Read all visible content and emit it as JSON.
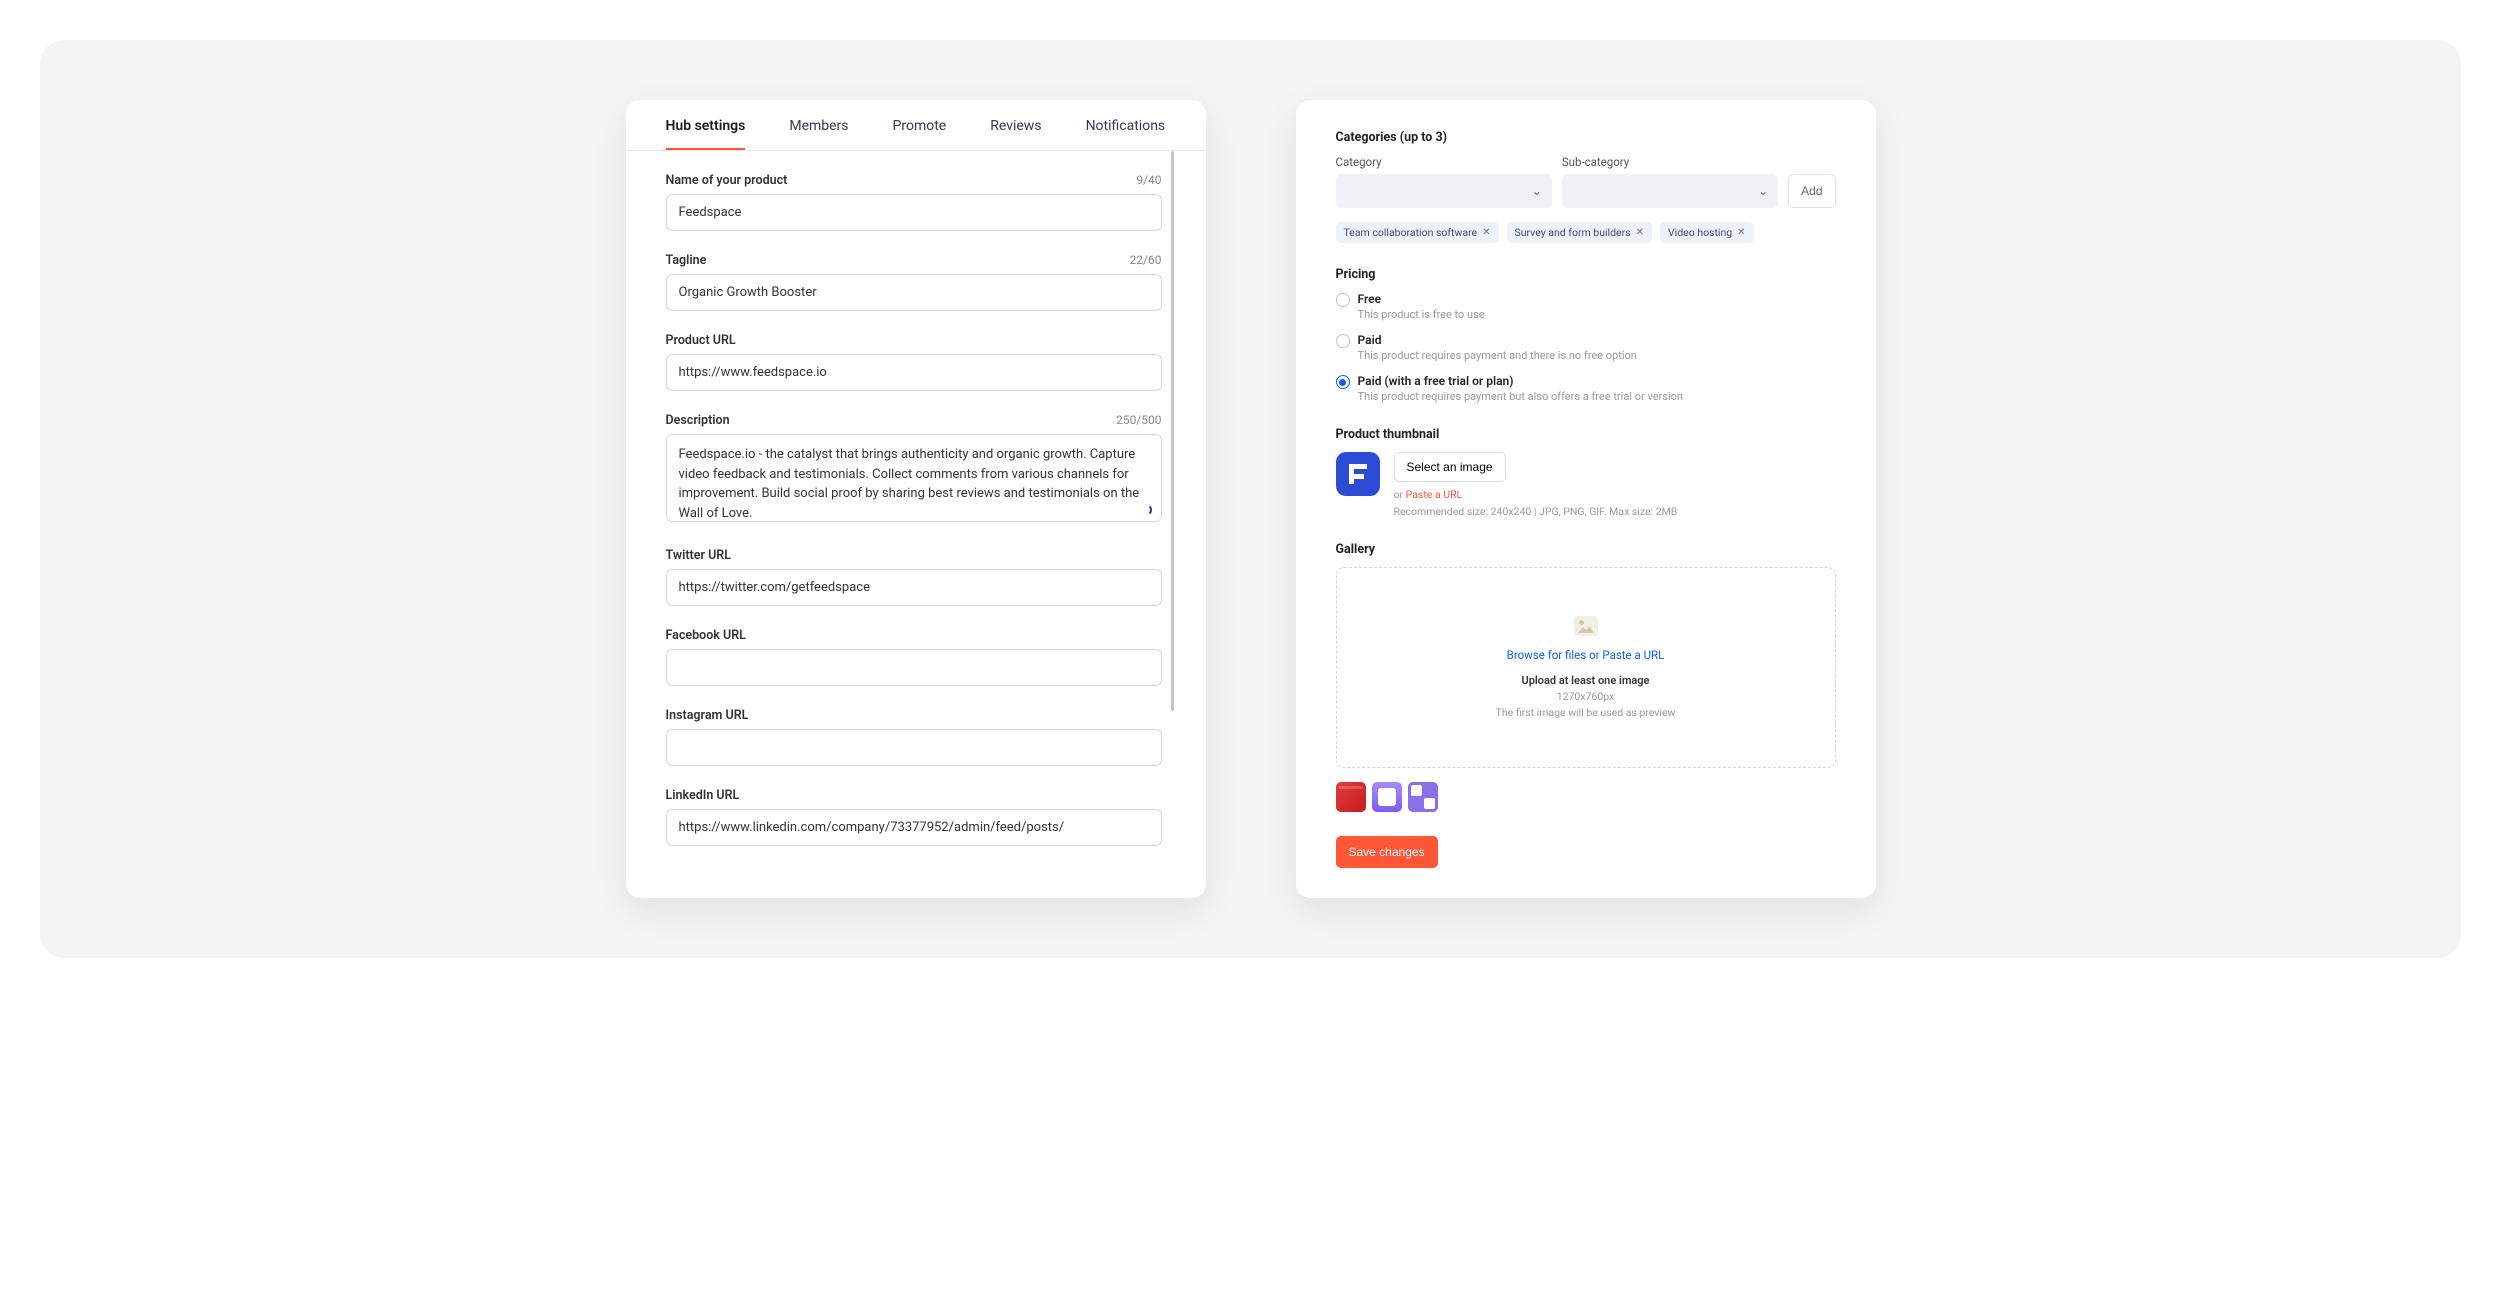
{
  "tabs": {
    "hub_settings": "Hub settings",
    "members": "Members",
    "promote": "Promote",
    "reviews": "Reviews",
    "notifications": "Notifications"
  },
  "fields": {
    "product_name": {
      "label": "Name of your product",
      "count": "9/40",
      "value": "Feedspace"
    },
    "tagline": {
      "label": "Tagline",
      "count": "22/60",
      "value": "Organic Growth Booster"
    },
    "product_url": {
      "label": "Product URL",
      "value": "https://www.feedspace.io"
    },
    "description": {
      "label": "Description",
      "count": "250/500",
      "value": "Feedspace.io - the catalyst that brings authenticity and organic growth. Capture video feedback and testimonials. Collect comments from various channels for improvement. Build social proof by sharing best reviews and testimonials on the Wall of Love."
    },
    "twitter": {
      "label": "Twitter URL",
      "value": "https://twitter.com/getfeedspace"
    },
    "facebook": {
      "label": "Facebook URL",
      "value": ""
    },
    "instagram": {
      "label": "Instagram URL",
      "value": ""
    },
    "linkedin": {
      "label": "LinkedIn URL",
      "value": "https://www.linkedin.com/company/73377952/admin/feed/posts/"
    }
  },
  "categories": {
    "heading": "Categories (up to 3)",
    "category_label": "Category",
    "subcategory_label": "Sub-category",
    "add_label": "Add",
    "chips": [
      "Team collaboration software",
      "Survey and form builders",
      "Video hosting"
    ]
  },
  "pricing": {
    "heading": "Pricing",
    "options": [
      {
        "label": "Free",
        "desc": "This product is free to use",
        "checked": false
      },
      {
        "label": "Paid",
        "desc": "This product requires payment and there is no free option",
        "checked": false
      },
      {
        "label": "Paid (with a free trial or plan)",
        "desc": "This product requires payment but also offers a free trial or version",
        "checked": true
      }
    ]
  },
  "thumbnail": {
    "heading": "Product thumbnail",
    "select_label": "Select an image",
    "or_text": "or ",
    "paste_link": "Paste a URL",
    "hint": "Recommended size: 240x240 | JPG, PNG, GIF. Max size: 2MB"
  },
  "gallery": {
    "heading": "Gallery",
    "browse_text": "Browse for files or Paste a URL",
    "title": "Upload at least one image",
    "size": "1270x760px",
    "note": "The first image will be used as preview"
  },
  "save_label": "Save changes"
}
